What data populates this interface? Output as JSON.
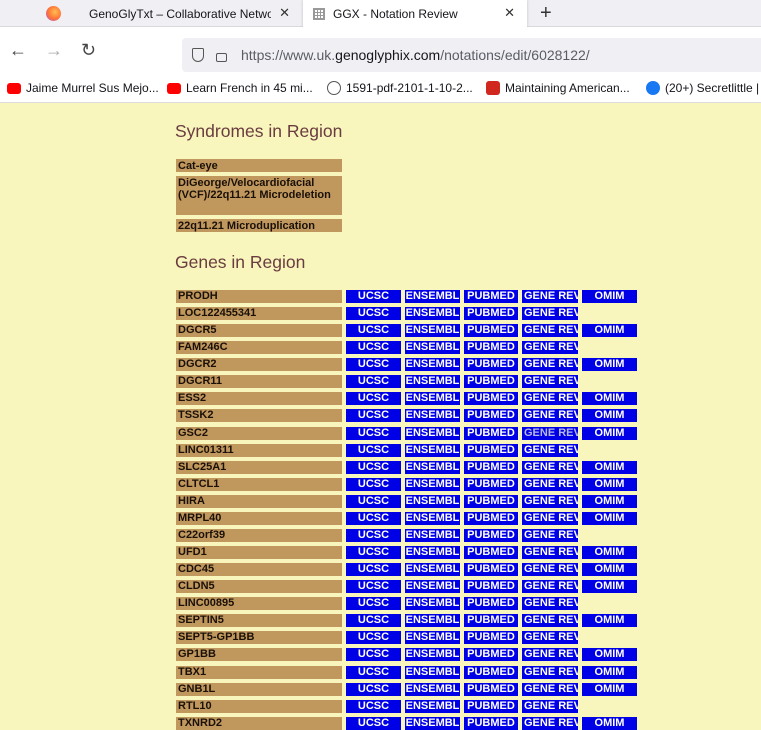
{
  "tabs": [
    {
      "title": "GenoGlyTxt – Collaborative Network",
      "active": false
    },
    {
      "title": "GGX - Notation Review",
      "active": true
    }
  ],
  "tab_close_glyph": "✕",
  "new_tab_glyph": "+",
  "url": {
    "prefix": "https://www.uk.",
    "domain": "genoglyphix.com",
    "path": "/notations/edit/6028122/"
  },
  "bookmarks": [
    {
      "label": "Jaime Murrel Sus Mejo...",
      "icon": "youtube-icon",
      "color": "#ff0000"
    },
    {
      "label": "Learn French in 45 mi...",
      "icon": "youtube-icon",
      "color": "#ff0000"
    },
    {
      "label": "1591-pdf-2101-1-10-2...",
      "icon": "globe-icon",
      "color": "#555555"
    },
    {
      "label": "Maintaining American...",
      "icon": "e-icon",
      "color": "#d0281e"
    },
    {
      "label": "(20+) Secretlittle |",
      "icon": "facebook-icon",
      "color": "#1877f2"
    }
  ],
  "sections": {
    "syndromes_title": "Syndromes in Region",
    "genes_title": "Genes in Region"
  },
  "syndromes": [
    "Cat-eye",
    "DiGeorge/Velocardiofacial (VCF)/22q11.21 Microdeletion",
    "22q11.21 Microduplication"
  ],
  "link_labels": {
    "ucsc": "UCSC",
    "ensembl": "ENSEMBL",
    "pubmed": "PUBMED",
    "gene_reviews": "GENE REV",
    "omim": "OMIM"
  },
  "genes": [
    {
      "name": "PRODH",
      "omim": true
    },
    {
      "name": "LOC122455341",
      "omim": false
    },
    {
      "name": "DGCR5",
      "omim": true
    },
    {
      "name": "FAM246C",
      "omim": false
    },
    {
      "name": "DGCR2",
      "omim": true
    },
    {
      "name": "DGCR11",
      "omim": false
    },
    {
      "name": "ESS2",
      "omim": true
    },
    {
      "name": "TSSK2",
      "omim": true
    },
    {
      "name": "GSC2",
      "omim": true,
      "gene_rev_visited": true
    },
    {
      "name": "LINC01311",
      "omim": false
    },
    {
      "name": "SLC25A1",
      "omim": true
    },
    {
      "name": "CLTCL1",
      "omim": true
    },
    {
      "name": "HIRA",
      "omim": true
    },
    {
      "name": "MRPL40",
      "omim": true
    },
    {
      "name": "C22orf39",
      "omim": false
    },
    {
      "name": "UFD1",
      "omim": true
    },
    {
      "name": "CDC45",
      "omim": true
    },
    {
      "name": "CLDN5",
      "omim": true
    },
    {
      "name": "LINC00895",
      "omim": false
    },
    {
      "name": "SEPTIN5",
      "omim": true
    },
    {
      "name": "SEPT5-GP1BB",
      "omim": false
    },
    {
      "name": "GP1BB",
      "omim": true
    },
    {
      "name": "TBX1",
      "omim": true
    },
    {
      "name": "GNB1L",
      "omim": true
    },
    {
      "name": "RTL10",
      "omim": false
    },
    {
      "name": "TXNRD2",
      "omim": true
    }
  ]
}
